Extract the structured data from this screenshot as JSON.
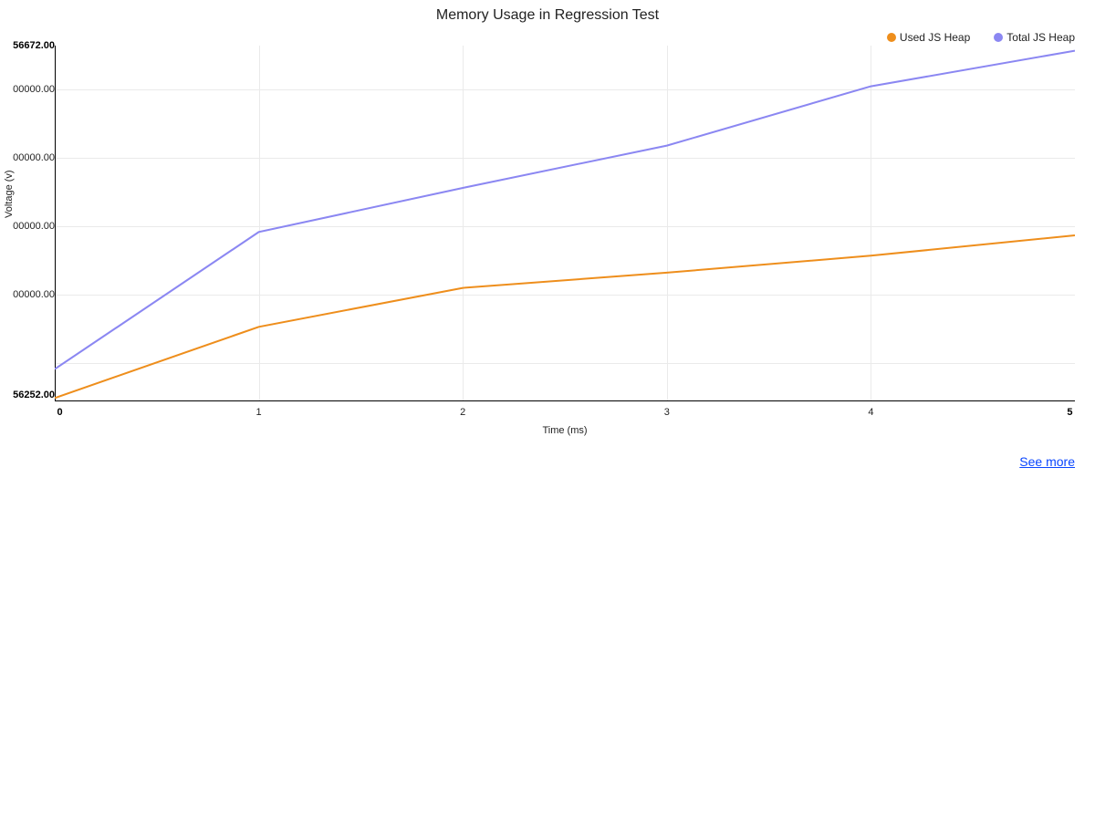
{
  "title": "Memory Usage in Regression Test",
  "legend": {
    "used": "Used JS Heap",
    "total": "Total JS Heap"
  },
  "axes": {
    "xlabel": "Time (ms)",
    "ylabel": "Voltage (v)"
  },
  "yticks": {
    "top": "56672.00",
    "bottom": "56252.00",
    "i1": "00000.00",
    "i2": "00000.00",
    "i3": "00000.00",
    "i4": "00000.00"
  },
  "xticks": {
    "0": "0",
    "1": "1",
    "2": "2",
    "3": "3",
    "4": "4",
    "5": "5"
  },
  "link": "See more",
  "colors": {
    "used": "#ee8e1c",
    "total": "#8b87f2",
    "link": "#0a46ff"
  },
  "chart_data": {
    "type": "line",
    "title": "Memory Usage in Regression Test",
    "xlabel": "Time (ms)",
    "ylabel": "Voltage (v)",
    "x": [
      0,
      1,
      2,
      3,
      4,
      5
    ],
    "xlim": [
      0,
      5
    ],
    "ylim": [
      56252,
      56672
    ],
    "series": [
      {
        "name": "Used JS Heap",
        "color": "#ee8e1c",
        "values": [
          56256,
          56340,
          56386,
          56404,
          56424,
          56448
        ]
      },
      {
        "name": "Total JS Heap",
        "color": "#8b87f2",
        "values": [
          56290,
          56452,
          56504,
          56554,
          56624,
          56666
        ]
      }
    ],
    "legend_position": "top-right",
    "grid": true
  }
}
